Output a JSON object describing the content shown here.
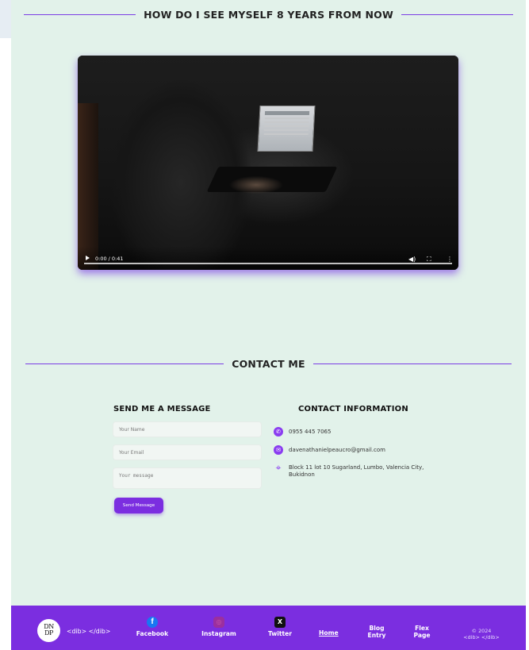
{
  "sections": {
    "future_title": "HOW DO I SEE MYSELF 8 YEARS FROM NOW",
    "contact_title": "CONTACT ME"
  },
  "video": {
    "time": "0:00 / 0:41",
    "progress_fraction": 0.0
  },
  "form": {
    "heading": "SEND ME A MESSAGE",
    "name_placeholder": "Your Name",
    "email_placeholder": "Your Email",
    "message_placeholder": "Your message",
    "submit_label": "Send Message"
  },
  "contact_info": {
    "heading": "CONTACT INFORMATION",
    "phone": "0955 445 7065",
    "email": "davenathanielpeaucro@gmail.com",
    "address": "Block 11 lot 10 Sugarland, Lumbo, Valencia City, Bukidnon"
  },
  "footer": {
    "logo_line1": "DN",
    "logo_line2": "DP",
    "brand": "<dib> </dib>",
    "social": [
      {
        "label": "Facebook",
        "icon": "facebook-icon"
      },
      {
        "label": "Instagram",
        "icon": "instagram-icon"
      },
      {
        "label": "Twitter",
        "icon": "x-twitter-icon"
      }
    ],
    "nav": {
      "home": "Home",
      "blog": "Blog Entry",
      "flex": "Flex Page"
    },
    "copyright_line1": "© 2024",
    "copyright_line2": "<dib> </dib>"
  },
  "colors": {
    "accent": "#7b2ee0",
    "background": "#e2f2ea"
  }
}
